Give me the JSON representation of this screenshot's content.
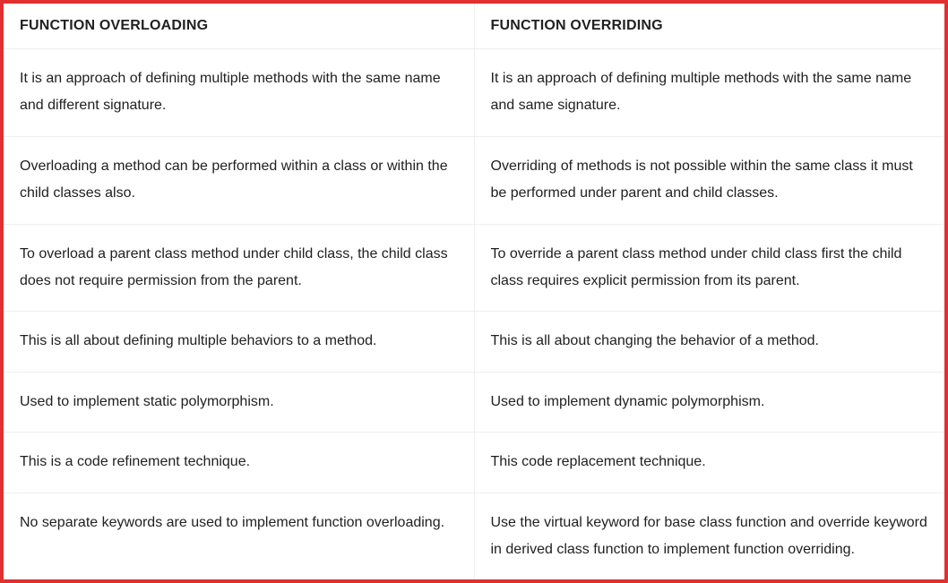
{
  "table": {
    "headers": {
      "col1": "FUNCTION OVERLOADING",
      "col2": "FUNCTION OVERRIDING"
    },
    "rows": [
      {
        "col1": "It is an approach of defining multiple methods with the same name and different signature.",
        "col2": "It is an approach of defining multiple methods with the same name and same signature."
      },
      {
        "col1": "Overloading a method can be performed within a class or within the child classes also.",
        "col2": "Overriding of methods is not possible within the same class it must be performed under parent and child classes."
      },
      {
        "col1": "To overload a parent class method under child class, the child class does not require permission from the parent.",
        "col2": "To override a parent class method under child class first the child class requires explicit permission from its parent."
      },
      {
        "col1": "This is all about defining multiple behaviors to a method.",
        "col2": "This is all about changing the behavior of a method."
      },
      {
        "col1": "Used to implement static polymorphism.",
        "col2": "Used to implement dynamic polymorphism."
      },
      {
        "col1": "This is a code refinement technique.",
        "col2": "This code replacement technique."
      },
      {
        "col1": "No separate keywords are used to implement function overloading.",
        "col2": "Use the virtual keyword for base class function and override keyword in derived class function to implement function overriding."
      }
    ]
  }
}
